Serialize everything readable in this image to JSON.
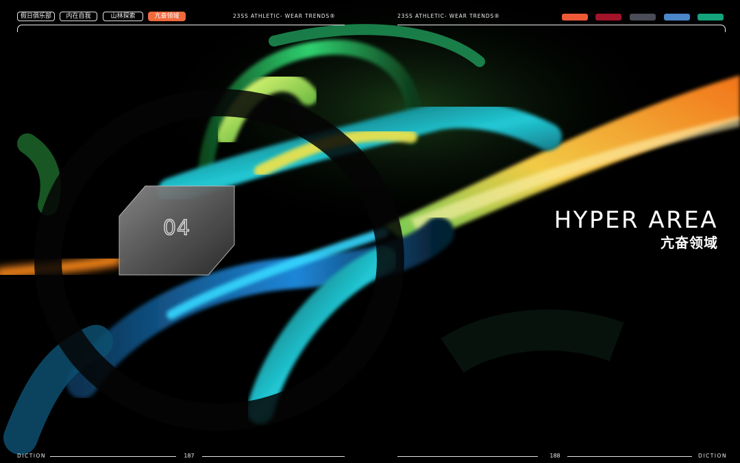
{
  "nav": {
    "tabs": [
      {
        "label": "假日俱乐部"
      },
      {
        "label": "内在自我"
      },
      {
        "label": "山林探索"
      },
      {
        "label": "亢奋领域"
      }
    ],
    "active_index": 3
  },
  "header": {
    "left_trend_label": "23SS ATHLETIC- WEAR TRENDS®",
    "right_trend_label": "23SS ATHLETIC- WEAR TRENDS®"
  },
  "palette": {
    "swatches": [
      "#ef5a36",
      "#a3142a",
      "#4a4c57",
      "#4b86c8",
      "#15a37c"
    ]
  },
  "chapter": {
    "number": "04",
    "title_en": "HYPER AREA",
    "title_cn": "亢奋领域"
  },
  "footer": {
    "left_brand": "DICTION",
    "right_brand": "DICTION",
    "left_page": "187",
    "right_page": "188"
  },
  "colors": {
    "accent": "#ef6a3d",
    "text": "#ffffff",
    "background": "#000000"
  }
}
